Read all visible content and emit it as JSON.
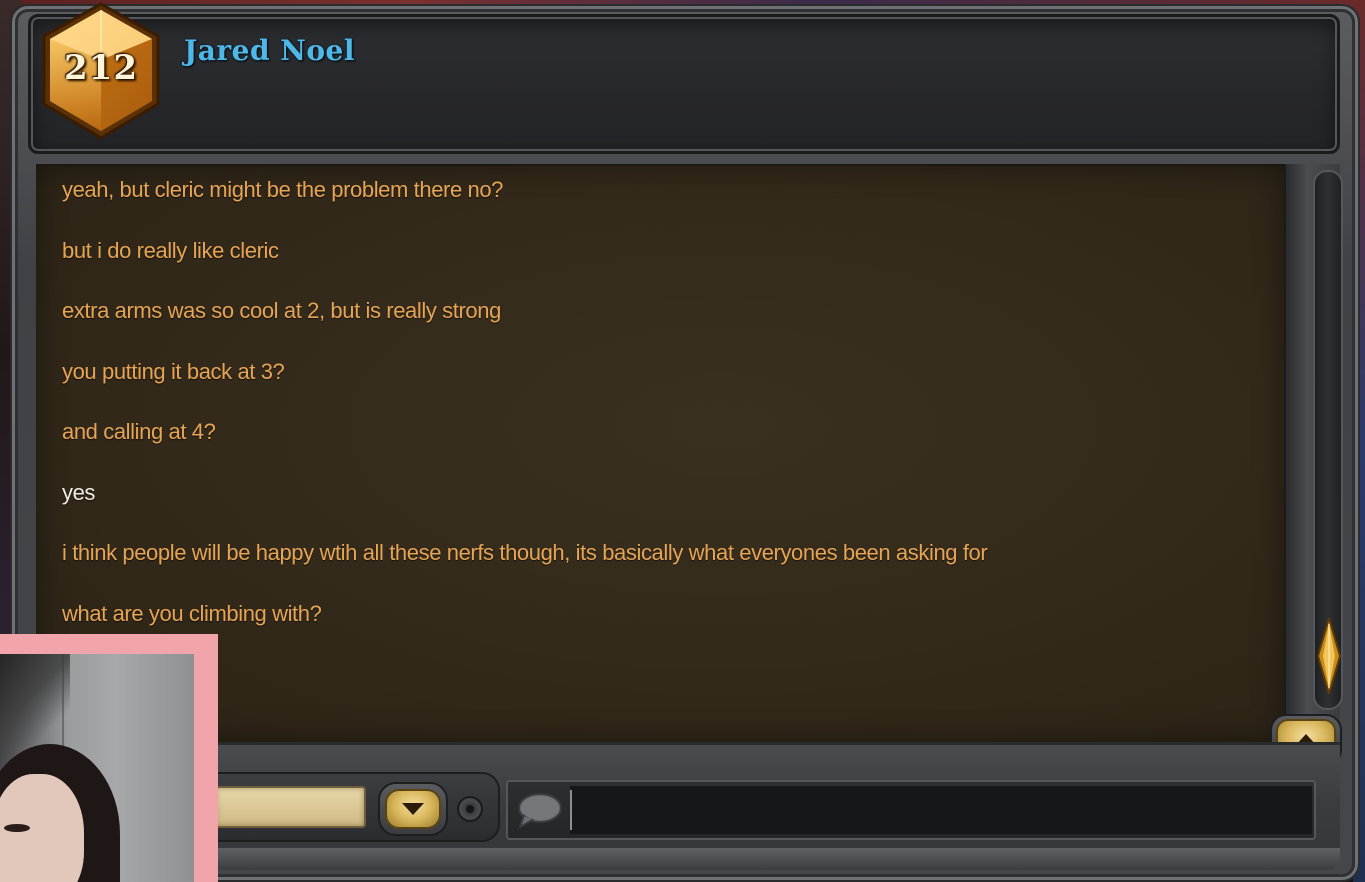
{
  "header": {
    "rank": "212",
    "player_name": "Jared Noel"
  },
  "chat": {
    "messages": [
      {
        "text": "yeah, but cleric might be the problem there no?",
        "from": "friend"
      },
      {
        "text": "but i do really like cleric",
        "from": "friend"
      },
      {
        "text": "extra arms was so cool at 2, but is really strong",
        "from": "friend"
      },
      {
        "text": "you putting it back at 3?",
        "from": "friend"
      },
      {
        "text": "and  calling at 4?",
        "from": "friend"
      },
      {
        "text": "yes",
        "from": "self"
      },
      {
        "text": "i think people will be happy wtih all these nerfs though, its basically what everyones been asking for",
        "from": "friend"
      },
      {
        "text": "what are you climbing with?",
        "from": "friend"
      }
    ],
    "colors": {
      "friend_text": "#e6a455",
      "self_text": "#f1ede4",
      "player_name": "#4fb8e8"
    }
  },
  "input": {
    "value": "",
    "placeholder": ""
  },
  "icons": {
    "rank_gem": "rank-gem-icon",
    "chat_bubble": "chat-bubble-icon",
    "scroll_up": "arrow-up-icon",
    "dropdown": "arrow-down-icon",
    "scroll_thumb": "diamond-scroll-icon"
  }
}
